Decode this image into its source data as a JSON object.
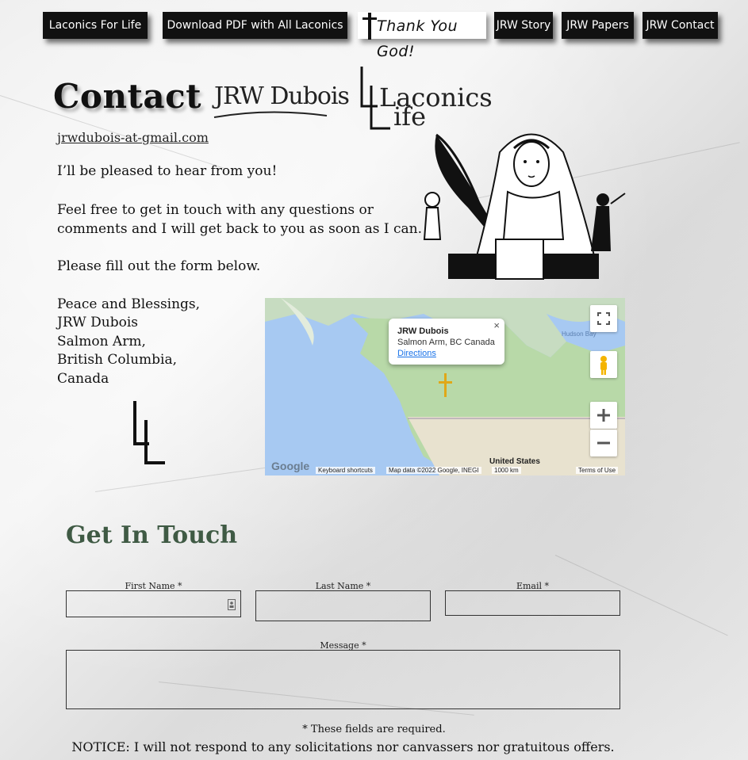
{
  "nav": {
    "items": [
      {
        "label": "Laconics For Life"
      },
      {
        "label": "Download PDF with All Laconics"
      },
      {
        "label": "Thank You God!"
      },
      {
        "label": "JRW Story"
      },
      {
        "label": "JRW Papers"
      },
      {
        "label": "JRW Contact"
      }
    ]
  },
  "header": {
    "title": "Contact",
    "logo_jrw": "JRW Dubois",
    "logo_laconics_top": "Laconics",
    "logo_laconics_bottom": "ife"
  },
  "contact": {
    "email": "jrwdubois-at-gmail.com",
    "greeting": "I’ll be pleased to hear from you!",
    "para1_line1": "Feel free to get in touch with any questions or",
    "para1_line2": "comments and I will get back to you as soon as I can.",
    "para2": "Please fill out the form below.",
    "sig_line1": "Peace and Blessings,",
    "sig_line2": "JRW Dubois",
    "sig_line3": "Salmon Arm,",
    "sig_line4": "British Columbia,",
    "sig_line5": "Canada"
  },
  "map": {
    "popup_title": "JRW Dubois",
    "popup_address": "Salmon Arm, BC Canada",
    "popup_link": "Directions",
    "label_us": "United States",
    "label_hudson": "Hudson Bay",
    "footer_shortcuts": "Keyboard shortcuts",
    "footer_data": "Map data ©2022 Google, INEGI",
    "footer_scale": "1000 km",
    "footer_terms": "Terms of Use",
    "google": "Google"
  },
  "form": {
    "heading": "Get In Touch",
    "first_name_label": "First Name *",
    "last_name_label": "Last Name *",
    "email_label": "Email *",
    "message_label": "Message *",
    "required_note": "* These fields are required.",
    "notice": "NOTICE: I will not respond to any solicitations nor canvassers nor gratuitous offers."
  },
  "colors": {
    "nav_bg": "#111111",
    "heading_green": "#3f5a44",
    "map_water": "#a7c9f2",
    "map_land": "#b8d9a8"
  }
}
